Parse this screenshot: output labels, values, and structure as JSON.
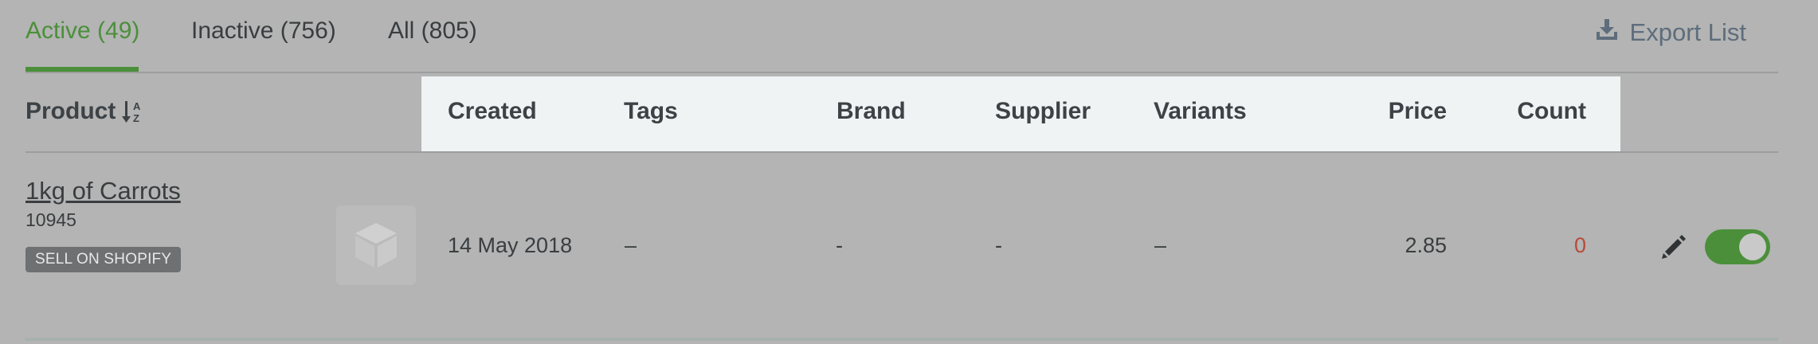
{
  "tabs": [
    {
      "label": "Active (49)",
      "active": true
    },
    {
      "label": "Inactive (756)",
      "active": false
    },
    {
      "label": "All (805)",
      "active": false
    }
  ],
  "export": {
    "label": "Export List",
    "icon": "download-icon"
  },
  "table": {
    "columns": {
      "product": "Product",
      "created": "Created",
      "tags": "Tags",
      "brand": "Brand",
      "supplier": "Supplier",
      "variants": "Variants",
      "price": "Price",
      "count": "Count"
    },
    "sort_icon": "sort-alpha-down-icon",
    "rows": [
      {
        "name": "1kg of Carrots",
        "sku": "10945",
        "badge": "SELL ON SHOPIFY",
        "created": "14 May 2018",
        "tags": "–",
        "brand": "-",
        "supplier": "-",
        "variants": "–",
        "price": "2.85",
        "count": "0",
        "active": true
      }
    ]
  },
  "colors": {
    "accent": "#4b8f3a",
    "count_zero": "#b94a3a",
    "export": "#5e6d7c"
  }
}
